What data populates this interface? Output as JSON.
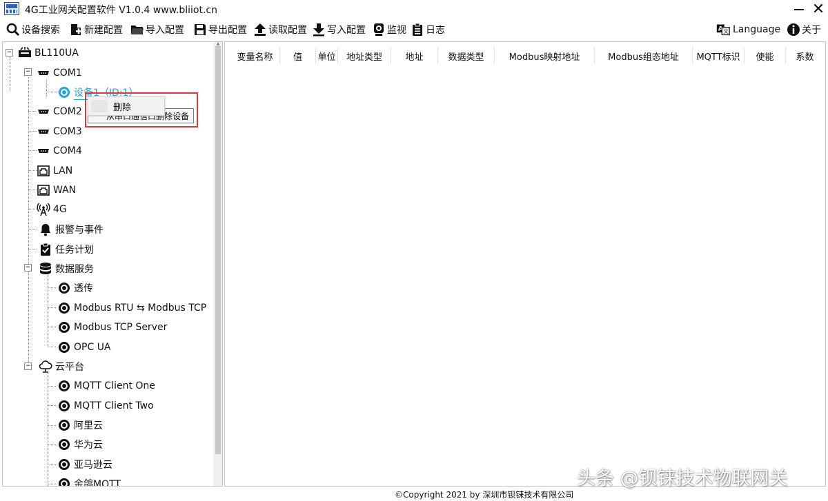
{
  "window": {
    "title": "4G工业网关配置软件 V1.0.4 www.bliiot.cn",
    "minimize": "—",
    "close": "✕"
  },
  "toolbar": {
    "search": "设备搜索",
    "new_config": "新建配置",
    "import_config": "导入配置",
    "export_config": "导出配置",
    "read_config": "读取配置",
    "write_config": "写入配置",
    "monitor": "监视",
    "log": "日志",
    "language": "Language",
    "about": "关于"
  },
  "tree": {
    "root": "BL110UA",
    "com1": "COM1",
    "device1": "设备1（ID:1）",
    "com2": "COM2",
    "com3": "COM3",
    "com4": "COM4",
    "lan": "LAN",
    "wan": "WAN",
    "g4": "4G",
    "alarm": "报警与事件",
    "tasks": "任务计划",
    "data_service": "数据服务",
    "transparent": "透传",
    "rtu_tcp": "Modbus RTU ⇆ Modbus TCP",
    "tcp_server": "Modbus TCP Server",
    "opc_ua": "OPC UA",
    "cloud": "云平台",
    "mqtt_one": "MQTT Client One",
    "mqtt_two": "MQTT Client Two",
    "aliyun": "阿里云",
    "huawei": "华为云",
    "aws": "亚马逊云",
    "jinge": "金鸽MQTT"
  },
  "context_menu": {
    "delete": "删除",
    "tooltip": "从串口通信口删除设备"
  },
  "table": {
    "columns": [
      "变量名称",
      "值",
      "单位",
      "地址类型",
      "地址",
      "数据类型",
      "Modbus映射地址",
      "Modbus组态地址",
      "MQTT标识",
      "使能",
      "系数"
    ]
  },
  "footer": {
    "copyright": "©Copyright 2021 by 深圳市钡铼技术有限公司",
    "watermark": "头条 @钡铼技术物联网关"
  }
}
